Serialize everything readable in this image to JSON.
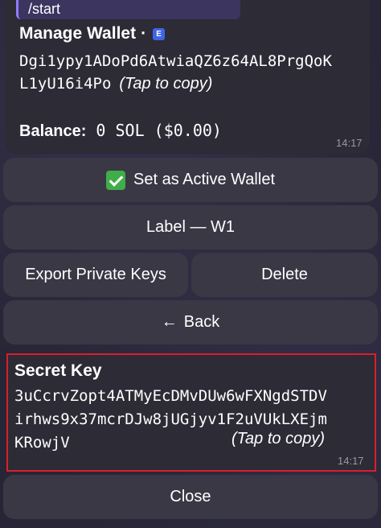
{
  "command": "/start",
  "wallet": {
    "title": "Manage Wallet",
    "separator": "·",
    "badge": "E",
    "address_line1": "Dgi1ypy1ADoPd6AtwiaQZ6z64AL8PrgQoK",
    "address_line2": "L1yU16i4Po",
    "tap_to_copy": "(Tap to copy)",
    "balance_label": "Balance:",
    "balance_value": " 0 SOL ($0.00)",
    "time": "14:17"
  },
  "buttons": {
    "set_active": "Set as Active Wallet",
    "label": "Label — W1",
    "export_keys": "Export Private Keys",
    "delete": "Delete",
    "back": "Back",
    "close": "Close"
  },
  "icons": {
    "set_active_icon": "check-mark-button-icon",
    "back_icon": "left-arrow-icon",
    "back_glyph": "←"
  },
  "secret": {
    "title": "Secret Key",
    "key_line1": "3uCcrvZopt4ATMyEcDMvDUw6wFXNgdSTDV",
    "key_line2": "irhws9x37mcrDJw8jUGjyv1F2uVUkLXEjm",
    "key_line3": "KRowjV",
    "tap_to_copy": "(Tap to copy)",
    "time": "14:17"
  },
  "colors": {
    "accent": "#8f7dff",
    "highlight_border": "#d7202a",
    "button_bg": "#3a3845",
    "bubble_bg": "#2d2b36"
  }
}
